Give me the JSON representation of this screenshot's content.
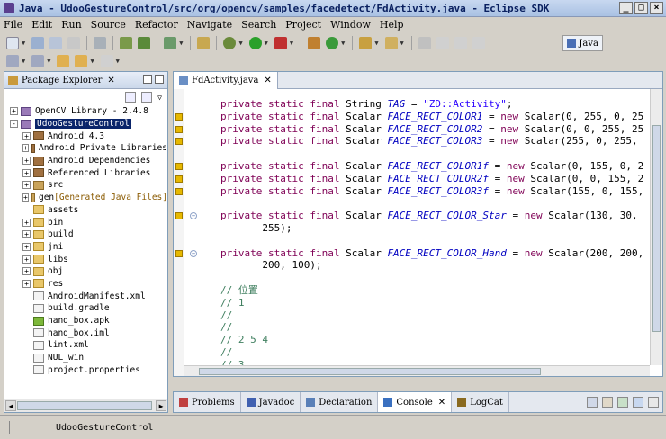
{
  "window": {
    "title": "Java - UdooGestureControl/src/org/opencv/samples/facedetect/FdActivity.java - Eclipse SDK"
  },
  "menu": [
    "File",
    "Edit",
    "Run",
    "Source",
    "Refactor",
    "Navigate",
    "Search",
    "Project",
    "Window",
    "Help"
  ],
  "perspective": {
    "label": "Java"
  },
  "explorer": {
    "tab_label": "Package Explorer",
    "items": [
      {
        "label": "OpenCV Library - 2.4.8",
        "indent": 0,
        "icon": "project-icon",
        "expand": "+"
      },
      {
        "label": "UdooGestureControl",
        "indent": 0,
        "icon": "project-icon",
        "expand": "-",
        "selected": true
      },
      {
        "label": "Android 4.3",
        "indent": 1,
        "icon": "library-icon",
        "expand": "+"
      },
      {
        "label": "Android Private Libraries",
        "indent": 1,
        "icon": "library-icon",
        "expand": "+"
      },
      {
        "label": "Android Dependencies",
        "indent": 1,
        "icon": "library-icon",
        "expand": "+"
      },
      {
        "label": "Referenced Libraries",
        "indent": 1,
        "icon": "library-icon",
        "expand": "+"
      },
      {
        "label": "src",
        "indent": 1,
        "icon": "package-folder-icon",
        "expand": "+"
      },
      {
        "label": "gen",
        "decoration": "[Generated Java Files]",
        "indent": 1,
        "icon": "package-folder-icon",
        "expand": "+"
      },
      {
        "label": "assets",
        "indent": 1,
        "icon": "folder-icon",
        "expand": ""
      },
      {
        "label": "bin",
        "indent": 1,
        "icon": "folder-icon",
        "expand": "+"
      },
      {
        "label": "build",
        "indent": 1,
        "icon": "folder-icon",
        "expand": "+"
      },
      {
        "label": "jni",
        "indent": 1,
        "icon": "folder-icon",
        "expand": "+"
      },
      {
        "label": "libs",
        "indent": 1,
        "icon": "folder-icon",
        "expand": "+"
      },
      {
        "label": "obj",
        "indent": 1,
        "icon": "folder-icon",
        "expand": "+"
      },
      {
        "label": "res",
        "indent": 1,
        "icon": "folder-icon",
        "expand": "+"
      },
      {
        "label": "AndroidManifest.xml",
        "indent": 1,
        "icon": "file-icon",
        "expand": ""
      },
      {
        "label": "build.gradle",
        "indent": 1,
        "icon": "file-icon",
        "expand": ""
      },
      {
        "label": "hand_box.apk",
        "indent": 1,
        "icon": "apk-icon",
        "expand": ""
      },
      {
        "label": "hand_box.iml",
        "indent": 1,
        "icon": "file-icon",
        "expand": ""
      },
      {
        "label": "lint.xml",
        "indent": 1,
        "icon": "file-icon",
        "expand": ""
      },
      {
        "label": "NUL_win",
        "indent": 1,
        "icon": "file-icon",
        "expand": ""
      },
      {
        "label": "project.properties",
        "indent": 1,
        "icon": "file-icon",
        "expand": ""
      }
    ]
  },
  "editor": {
    "tab_label": "FdActivity.java",
    "lines": [
      [
        [
          "kw",
          "private static final "
        ],
        [
          "",
          "String "
        ],
        [
          "fld",
          "TAG"
        ],
        [
          "",
          " = "
        ],
        [
          "str",
          "\"ZD::Activity\""
        ],
        [
          "",
          ";"
        ]
      ],
      [
        [
          "kw",
          "private static final "
        ],
        [
          "",
          "Scalar "
        ],
        [
          "fld",
          "FACE_RECT_COLOR1"
        ],
        [
          "",
          " = "
        ],
        [
          "kw",
          "new "
        ],
        [
          "",
          "Scalar(0, 255, 0, 25"
        ]
      ],
      [
        [
          "kw",
          "private static final "
        ],
        [
          "",
          "Scalar "
        ],
        [
          "fld",
          "FACE_RECT_COLOR2"
        ],
        [
          "",
          " = "
        ],
        [
          "kw",
          "new "
        ],
        [
          "",
          "Scalar(0, 0, 255, 25"
        ]
      ],
      [
        [
          "kw",
          "private static final "
        ],
        [
          "",
          "Scalar "
        ],
        [
          "fld",
          "FACE_RECT_COLOR3"
        ],
        [
          "",
          " = "
        ],
        [
          "kw",
          "new "
        ],
        [
          "",
          "Scalar(255, 0, 255,"
        ]
      ],
      [],
      [
        [
          "kw",
          "private static final "
        ],
        [
          "",
          "Scalar "
        ],
        [
          "fld",
          "FACE_RECT_COLOR1f"
        ],
        [
          "",
          " = "
        ],
        [
          "kw",
          "new "
        ],
        [
          "",
          "Scalar(0, 155, 0, 2"
        ]
      ],
      [
        [
          "kw",
          "private static final "
        ],
        [
          "",
          "Scalar "
        ],
        [
          "fld",
          "FACE_RECT_COLOR2f"
        ],
        [
          "",
          " = "
        ],
        [
          "kw",
          "new "
        ],
        [
          "",
          "Scalar(0, 0, 155, 2"
        ]
      ],
      [
        [
          "kw",
          "private static final "
        ],
        [
          "",
          "Scalar "
        ],
        [
          "fld",
          "FACE_RECT_COLOR3f"
        ],
        [
          "",
          " = "
        ],
        [
          "kw",
          "new "
        ],
        [
          "",
          "Scalar(155, 0, 155,"
        ]
      ],
      [],
      [
        [
          "kw",
          "private static final "
        ],
        [
          "",
          "Scalar "
        ],
        [
          "fld",
          "FACE_RECT_COLOR_Star"
        ],
        [
          "",
          " = "
        ],
        [
          "kw",
          "new "
        ],
        [
          "",
          "Scalar(130, 30,"
        ]
      ],
      [
        [
          "",
          "       255);"
        ]
      ],
      [],
      [
        [
          "kw",
          "private static final "
        ],
        [
          "",
          "Scalar "
        ],
        [
          "fld",
          "FACE_RECT_COLOR_Hand"
        ],
        [
          "",
          " = "
        ],
        [
          "kw",
          "new "
        ],
        [
          "",
          "Scalar(200, 200,"
        ]
      ],
      [
        [
          "",
          "       200, 100);"
        ]
      ],
      [],
      [
        [
          "cmt",
          "// 位置"
        ]
      ],
      [
        [
          "cmt",
          "// 1"
        ]
      ],
      [
        [
          "cmt",
          "//"
        ]
      ],
      [
        [
          "cmt",
          "//"
        ]
      ],
      [
        [
          "cmt",
          "// 2 5 4"
        ]
      ],
      [
        [
          "cmt",
          "//"
        ]
      ],
      [
        [
          "cmt",
          "// 3"
        ]
      ]
    ]
  },
  "bottom_tabs": [
    {
      "label": "Problems",
      "color": "#c04040",
      "active": false
    },
    {
      "label": "Javadoc",
      "color": "#4060b0",
      "active": false
    },
    {
      "label": "Declaration",
      "color": "#5a80b8",
      "active": false
    },
    {
      "label": "Console",
      "color": "#3a70c0",
      "active": true,
      "closable": true
    },
    {
      "label": "LogCat",
      "color": "#8a6a20",
      "active": false
    }
  ],
  "status": {
    "text": "UdooGestureControl"
  },
  "colors": {
    "keyword": "#7f0055",
    "string": "#2a00ff",
    "field": "#0000c0",
    "comment": "#3f7f5f",
    "selection": "#0a246a"
  }
}
